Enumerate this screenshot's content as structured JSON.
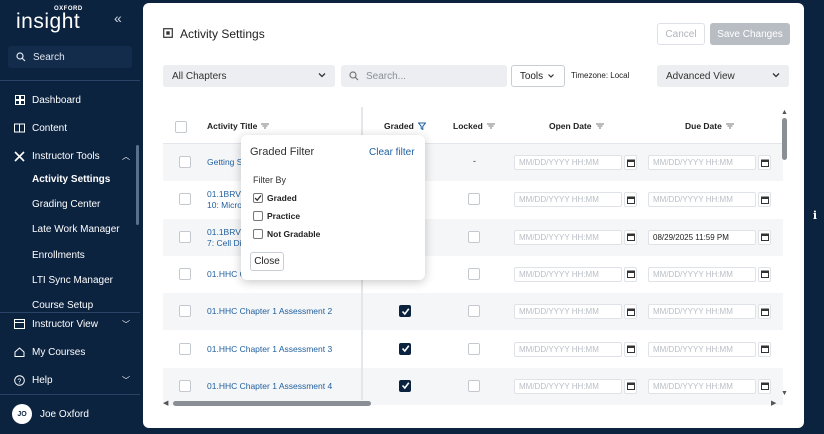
{
  "brand": {
    "small": "OXFORD",
    "main": "insight"
  },
  "sidebar": {
    "search_label": "Search",
    "items": [
      {
        "label": "Dashboard"
      },
      {
        "label": "Content"
      },
      {
        "label": "Instructor Tools"
      },
      {
        "label": "Instructor View"
      },
      {
        "label": "My Courses"
      },
      {
        "label": "Help"
      }
    ],
    "sub_items": [
      {
        "label": "Activity Settings"
      },
      {
        "label": "Grading Center"
      },
      {
        "label": "Late Work Manager"
      },
      {
        "label": "Enrollments"
      },
      {
        "label": "LTI Sync Manager"
      },
      {
        "label": "Course Setup"
      }
    ],
    "user": {
      "initials": "JO",
      "name": "Joe Oxford"
    }
  },
  "header": {
    "title": "Activity Settings",
    "cancel_label": "Cancel",
    "save_label": "Save Changes"
  },
  "toolbar": {
    "chapters_select": "All Chapters",
    "search_placeholder": "Search...",
    "tools_label": "Tools",
    "timezone": "Timezone: Local",
    "view_select": "Advanced View"
  },
  "table": {
    "columns": [
      "Activity Title",
      "Graded",
      "Locked",
      "Open Date",
      "Due Date"
    ],
    "date_placeholder": "MM/DD/YYYY HH:MM",
    "rows": [
      {
        "title": "Getting S",
        "title2": "",
        "graded": null,
        "locked_text": "-",
        "open": "",
        "due": ""
      },
      {
        "title": "01.1BRV",
        "title2": "10: Micro",
        "graded": false,
        "locked_text": "",
        "open": "",
        "due": ""
      },
      {
        "title": "01.1BRV",
        "title2": "7: Cell Di",
        "graded": false,
        "locked_text": "",
        "open": "",
        "due": "08/29/2025 11:59 PM"
      },
      {
        "title": "01.HHC C",
        "title2": "",
        "graded": false,
        "locked_text": "",
        "open": "",
        "due": ""
      },
      {
        "title": "01.HHC Chapter 1 Assessment 2",
        "title2": "",
        "graded": true,
        "locked_text": "",
        "open": "",
        "due": ""
      },
      {
        "title": "01.HHC Chapter 1 Assessment 3",
        "title2": "",
        "graded": true,
        "locked_text": "",
        "open": "",
        "due": ""
      },
      {
        "title": "01.HHC Chapter 1 Assessment 4",
        "title2": "",
        "graded": true,
        "locked_text": "",
        "open": "",
        "due": ""
      }
    ]
  },
  "graded_filter": {
    "title": "Graded Filter",
    "clear_label": "Clear filter",
    "filter_by_label": "Filter By",
    "options": [
      {
        "label": "Graded",
        "checked": true
      },
      {
        "label": "Practice",
        "checked": false
      },
      {
        "label": "Not Gradable",
        "checked": false
      }
    ],
    "close_label": "Close"
  },
  "info_badge": "i",
  "colors": {
    "sidebar_bg": "#0c2340",
    "link": "#1f5f9e",
    "checked": "#0c2340"
  }
}
